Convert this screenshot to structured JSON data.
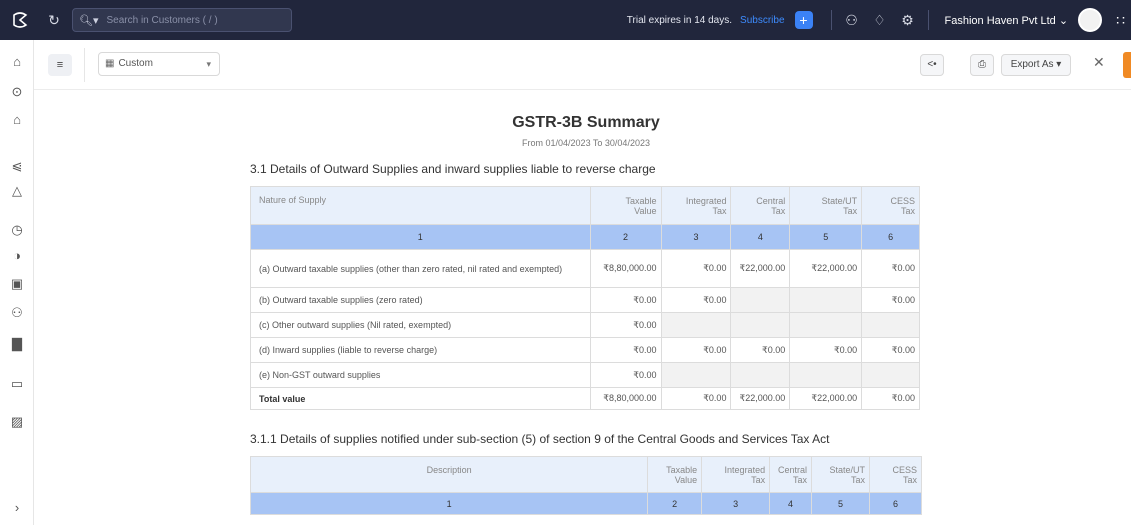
{
  "topbar": {
    "search_placeholder": "Search in Customers ( / )",
    "trial_text": "Trial expires in 14 days.",
    "subscribe_label": "Subscribe",
    "org_name": "Fashion Haven Pvt Ltd",
    "org_caret": "⌄"
  },
  "toolbar": {
    "period_label": "Custom",
    "export_label": "Export As",
    "export_caret": "▾"
  },
  "report": {
    "title": "GSTR-3B Summary",
    "period": "From 01/04/2023  To 30/04/2023",
    "section1": {
      "heading": "3.1 Details of Outward Supplies and inward supplies liable to reverse charge",
      "headers": [
        "Nature of Supply",
        "Taxable Value",
        "Integrated Tax",
        "Central Tax",
        "State/UT Tax",
        "CESS Tax"
      ],
      "header_lines": [
        [
          "Nature of Supply"
        ],
        [
          "Taxable",
          "Value"
        ],
        [
          "Integrated",
          "Tax"
        ],
        [
          "Central",
          "Tax"
        ],
        [
          "State/UT",
          "Tax"
        ],
        [
          "CESS",
          "Tax"
        ]
      ],
      "numbers": [
        "1",
        "2",
        "3",
        "4",
        "5",
        "6"
      ],
      "rows": [
        {
          "label": "(a) Outward taxable supplies (other than zero rated, nil rated and exempted)",
          "cells": [
            "₹8,80,000.00",
            "₹0.00",
            "₹22,000.00",
            "₹22,000.00",
            "₹0.00"
          ]
        },
        {
          "label": "(b) Outward taxable supplies (zero rated)",
          "cells": [
            "₹0.00",
            "₹0.00",
            "",
            "",
            "₹0.00"
          ]
        },
        {
          "label": "(c) Other outward supplies (Nil rated, exempted)",
          "cells": [
            "₹0.00",
            "",
            "",
            "",
            ""
          ]
        },
        {
          "label": "(d) Inward supplies (liable to reverse charge)",
          "cells": [
            "₹0.00",
            "₹0.00",
            "₹0.00",
            "₹0.00",
            "₹0.00"
          ]
        },
        {
          "label": "(e) Non-GST outward supplies",
          "cells": [
            "₹0.00",
            "",
            "",
            "",
            ""
          ]
        },
        {
          "label": "Total value",
          "cells": [
            "₹8,80,000.00",
            "₹0.00",
            "₹22,000.00",
            "₹22,000.00",
            "₹0.00"
          ]
        }
      ]
    },
    "section2": {
      "heading": "3.1.1 Details of supplies notified under sub-section (5) of section 9 of the Central Goods and Services Tax Act",
      "headers": [
        "Description",
        "Taxable Value",
        "Integrated Tax",
        "Central Tax",
        "State/UT Tax",
        "CESS Tax"
      ],
      "header_lines": [
        [
          "Description"
        ],
        [
          "Taxable",
          "Value"
        ],
        [
          "Integrated",
          "Tax"
        ],
        [
          "Central",
          "Tax"
        ],
        [
          "State/UT",
          "Tax"
        ],
        [
          "CESS",
          "Tax"
        ]
      ],
      "numbers": [
        "1",
        "2",
        "3",
        "4",
        "5",
        "6"
      ]
    }
  },
  "grey_cells": [
    [
      1,
      3
    ],
    [
      1,
      4
    ],
    [
      2,
      2
    ],
    [
      2,
      3
    ],
    [
      2,
      4
    ],
    [
      2,
      5
    ],
    [
      4,
      2
    ],
    [
      4,
      3
    ],
    [
      4,
      4
    ],
    [
      4,
      5
    ]
  ],
  "icons": {
    "logo": "logo-icon",
    "refresh": "refresh-icon",
    "search": "search-icon",
    "add": "plus-icon",
    "users": "users-icon",
    "bell": "bell-icon",
    "settings": "gear-icon",
    "apps": "apps-grid-icon",
    "menu": "menu-icon",
    "calendar": "calendar-icon",
    "share": "share-icon",
    "print": "print-icon",
    "close": "close-icon"
  }
}
